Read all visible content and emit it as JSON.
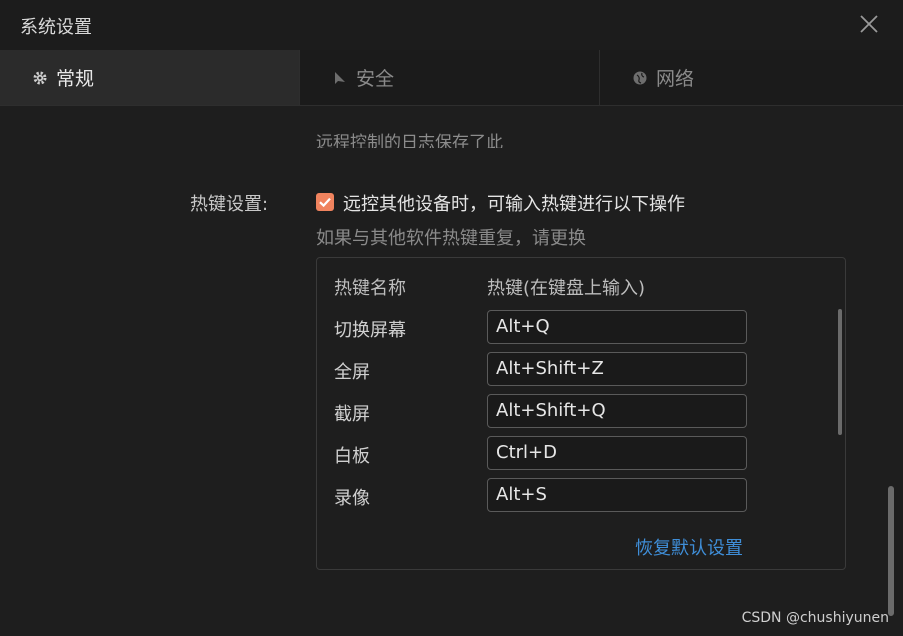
{
  "window": {
    "title": "系统设置"
  },
  "tabs": [
    {
      "label": "常规",
      "icon": "gear-icon",
      "active": true
    },
    {
      "label": "安全",
      "icon": "shield-icon",
      "active": false
    },
    {
      "label": "网络",
      "icon": "globe-icon",
      "active": false
    }
  ],
  "general": {
    "partial_text": "远程控制的日志保存了此",
    "hotkey_label": "热键设置:",
    "hotkey_checkbox_label": "远控其他设备时，可输入热键进行以下操作",
    "hotkey_checkbox_checked": true,
    "hotkey_hint": "如果与其他软件热键重复，请更换",
    "table": {
      "header_name": "热键名称",
      "header_key": "热键(在键盘上输入)",
      "rows": [
        {
          "name": "切换屏幕",
          "key": "Alt+Q"
        },
        {
          "name": "全屏",
          "key": "Alt+Shift+Z"
        },
        {
          "name": "截屏",
          "key": "Alt+Shift+Q"
        },
        {
          "name": "白板",
          "key": "Ctrl+D"
        },
        {
          "name": "录像",
          "key": "Alt+S"
        }
      ],
      "restore_label": "恢复默认设置"
    }
  },
  "watermark": "CSDN @chushiyunen",
  "colors": {
    "accent": "#f0835e",
    "link": "#3f8ed8",
    "background": "#1e1e1e"
  }
}
